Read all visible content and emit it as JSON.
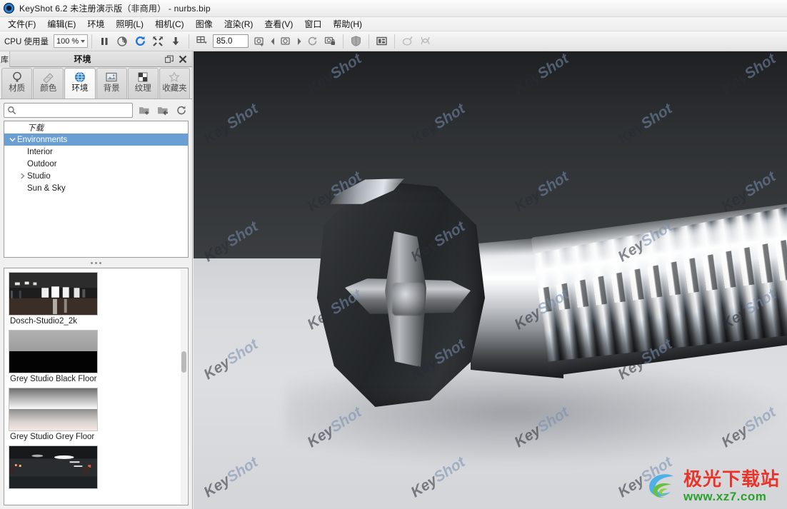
{
  "window": {
    "title": "KeyShot 6.2 未注册演示版（非商用） - nurbs.bip",
    "app_icon": "keyshot-logo-icon"
  },
  "menubar": {
    "items": [
      {
        "label": "文件(F)"
      },
      {
        "label": "编辑(E)"
      },
      {
        "label": "环境"
      },
      {
        "label": "照明(L)"
      },
      {
        "label": "相机(C)"
      },
      {
        "label": "图像"
      },
      {
        "label": "渲染(R)"
      },
      {
        "label": "查看(V)"
      },
      {
        "label": "窗口"
      },
      {
        "label": "帮助(H)"
      }
    ]
  },
  "toolbar": {
    "cpu_label": "CPU 使用量",
    "cpu_value": "100 %",
    "numeric_field_value": "85.0",
    "buttons": [
      {
        "name": "pause-render-icon",
        "title": "暂停"
      },
      {
        "name": "performance-mode-icon",
        "title": "性能模式"
      },
      {
        "name": "refresh-render-icon",
        "title": "刷新"
      },
      {
        "name": "resize-icon",
        "title": "调整大小"
      },
      {
        "name": "import-icon",
        "title": "导入"
      },
      {
        "name": "grid-icon",
        "title": "网格"
      },
      {
        "name": "camera-add-icon",
        "title": "添加相机"
      },
      {
        "name": "camera-prev-icon",
        "title": "上一个相机"
      },
      {
        "name": "camera-current-icon",
        "title": "当前相机"
      },
      {
        "name": "camera-next-icon",
        "title": "下一个相机"
      },
      {
        "name": "camera-reset-icon",
        "title": "重置相机"
      },
      {
        "name": "camera-lock-icon",
        "title": "锁定相机"
      },
      {
        "name": "shield-icon",
        "title": "材质"
      },
      {
        "name": "panel-layout-icon",
        "title": "面板"
      },
      {
        "name": "paint-icon",
        "title": "绘制"
      },
      {
        "name": "nurbs-icon",
        "title": "NURBS"
      }
    ]
  },
  "library_panel": {
    "side_tab_label": "库",
    "title": "环境",
    "header_buttons": [
      {
        "name": "undock-icon"
      },
      {
        "name": "close-icon"
      }
    ],
    "tabs": [
      {
        "label": "材质",
        "icon": "material-sphere-icon",
        "active": false
      },
      {
        "label": "颜色",
        "icon": "color-swatch-icon",
        "active": false
      },
      {
        "label": "环境",
        "icon": "globe-icon",
        "active": true
      },
      {
        "label": "背景",
        "icon": "image-icon",
        "active": false
      },
      {
        "label": "纹理",
        "icon": "checker-icon",
        "active": false
      },
      {
        "label": "收藏夹",
        "icon": "star-icon",
        "active": false
      }
    ],
    "search": {
      "placeholder": "",
      "value": "",
      "icon": "search-icon"
    },
    "search_buttons": [
      {
        "name": "add-folder-icon"
      },
      {
        "name": "import-folder-icon"
      },
      {
        "name": "refresh-library-icon"
      }
    ],
    "tree": [
      {
        "label": "下载",
        "indent": 1,
        "arrow": "none",
        "selected": false,
        "italic": true
      },
      {
        "label": "Environments",
        "indent": 0,
        "arrow": "down",
        "selected": true,
        "italic": false
      },
      {
        "label": "Interior",
        "indent": 1,
        "arrow": "none",
        "selected": false,
        "italic": false
      },
      {
        "label": "Outdoor",
        "indent": 1,
        "arrow": "none",
        "selected": false,
        "italic": false
      },
      {
        "label": "Studio",
        "indent": 0,
        "arrow": "right",
        "selected": false,
        "italic": false
      },
      {
        "label": "Sun & Sky",
        "indent": 1,
        "arrow": "none",
        "selected": false,
        "italic": false
      }
    ],
    "thumbnails": [
      {
        "label": "Dosch-Studio2_2k",
        "kind": "studio-interior"
      },
      {
        "label": "Grey Studio Black Floor",
        "kind": "grey-black"
      },
      {
        "label": "Grey Studio Grey Floor",
        "kind": "grey-grey"
      },
      {
        "label": "",
        "kind": "garage"
      }
    ]
  },
  "viewport": {
    "watermark_text_a": "Key",
    "watermark_text_b": "Shot",
    "backdrop_color": "#2e3134",
    "floor_color": "#d8dadd",
    "site_watermark": {
      "name_cn": "极光下载站",
      "url": "www.xz7.com"
    }
  }
}
